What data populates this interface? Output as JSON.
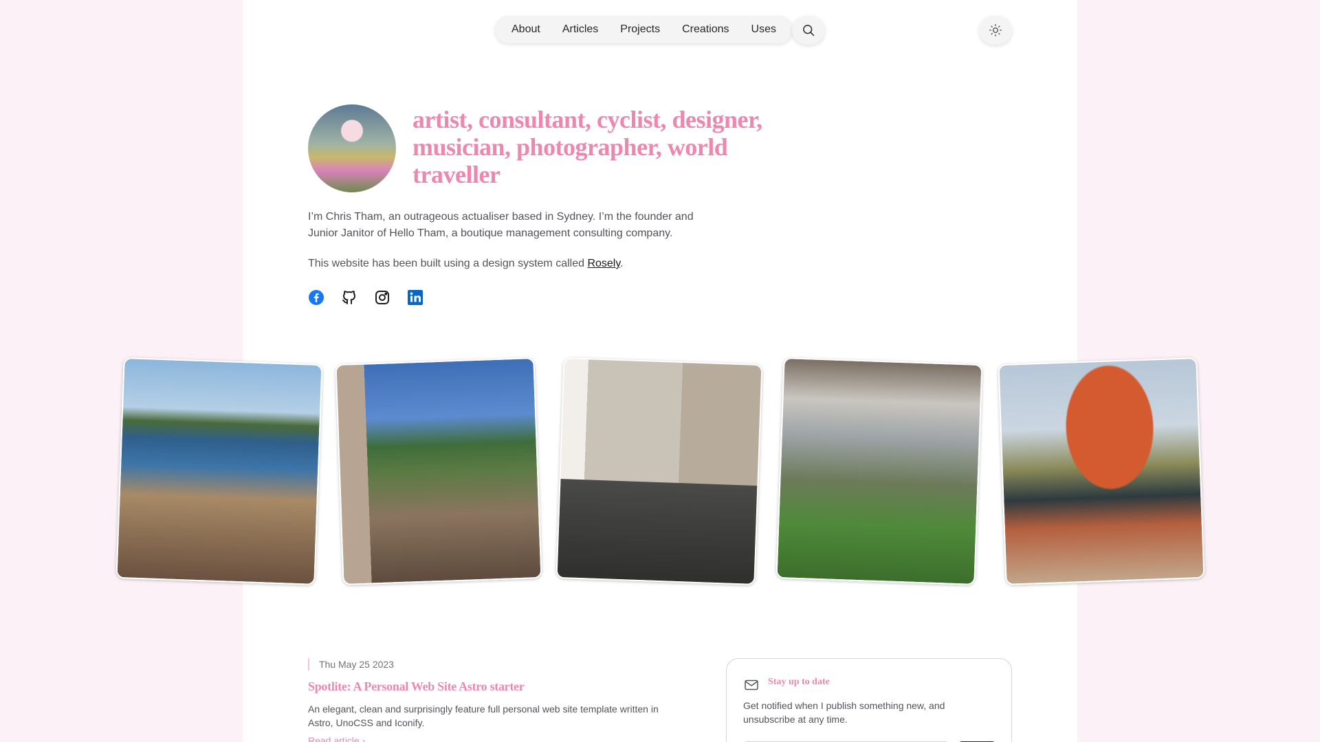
{
  "nav": {
    "items": [
      {
        "label": "About"
      },
      {
        "label": "Articles"
      },
      {
        "label": "Projects"
      },
      {
        "label": "Creations"
      },
      {
        "label": "Uses"
      }
    ],
    "search_icon": "search-icon",
    "theme_icon": "sun-icon"
  },
  "hero": {
    "headline": "artist, consultant, cyclist, designer, musician, photographer, world traveller",
    "intro": "I’m Chris Tham, an outrageous actualiser based in Sydney. I’m the founder and Junior Janitor of Hello Tham, a boutique management consulting company.",
    "built_prefix": "This website has been built using a design system called ",
    "built_link": "Rosely",
    "built_suffix": ".",
    "socials": [
      {
        "icon": "facebook-icon",
        "color": "#1877f2"
      },
      {
        "icon": "github-icon",
        "color": "#18181b"
      },
      {
        "icon": "instagram-icon",
        "color": "#18181b"
      },
      {
        "icon": "linkedin-icon",
        "color": "#0a66c2"
      }
    ]
  },
  "article": {
    "date": "Thu May 25 2023",
    "title": "Spotlite: A Personal Web Site Astro starter",
    "description": "An elegant, clean and surprisingly feature full personal web site template written in Astro, UnoCSS and Iconify.",
    "read_more": "Read article"
  },
  "newsletter": {
    "title": "Stay up to date",
    "text": "Get notified when I publish something new, and unsubscribe at any time."
  },
  "colors": {
    "accent": "#ec88b0",
    "page_bg": "#fbf1f6"
  }
}
